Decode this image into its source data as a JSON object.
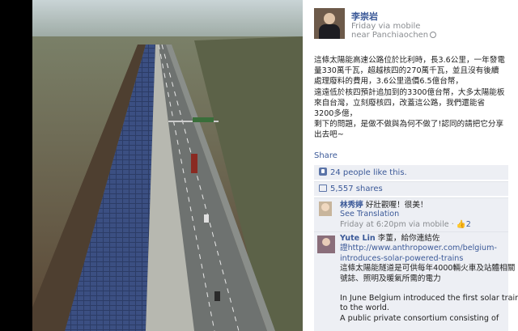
{
  "post": {
    "author": "李崇岩",
    "meta_line1": "Friday via mobile",
    "meta_line2": "near Panchiaochen",
    "lines": [
      "這條太陽能高速公路位於比利時，長3.6公里，一年發電",
      "量330萬千瓦，超越核四的270萬千瓦，並且沒有後續",
      "處理廢料的費用，3.6公里造價6.5億台幣，",
      "遠遠低於核四預計追加到的3300億台幣，大多太陽能板",
      "來自台灣，立刻廢核四，改蓋這公路，我們還能省",
      "3200多億，",
      "剩下的問題，是做不做與為何不做了!認同的請把它分享",
      "出去吧~"
    ],
    "share_label": "Share"
  },
  "stats": {
    "likes_text": "24 people like this.",
    "shares_text": "5,557 shares"
  },
  "comments": [
    {
      "name": "林秀婷",
      "text": "好壯觀喔！很美！",
      "translation_label": "See Translation",
      "meta": "Friday at 6:20pm via mobile · ",
      "like_count": "2"
    },
    {
      "name": "Yute Lin",
      "lines": [
        "李董，給你連結佐",
        "證http://www.anthropower.com/belgium-",
        "introduces-solar-powered-trains",
        "這條太陽能隧道是可供每年4000輛火車及站體相關",
        "號誌、照明及暖氣所需的電力",
        "",
        "In June Belgium introduced the first solar train",
        "to the world.",
        "A public private consortium consisting of"
      ]
    }
  ],
  "colors": {
    "link": "#3b5998",
    "panel_bg": "#edeff4",
    "solar": "#2e3d66",
    "forest": "#6b5540"
  }
}
